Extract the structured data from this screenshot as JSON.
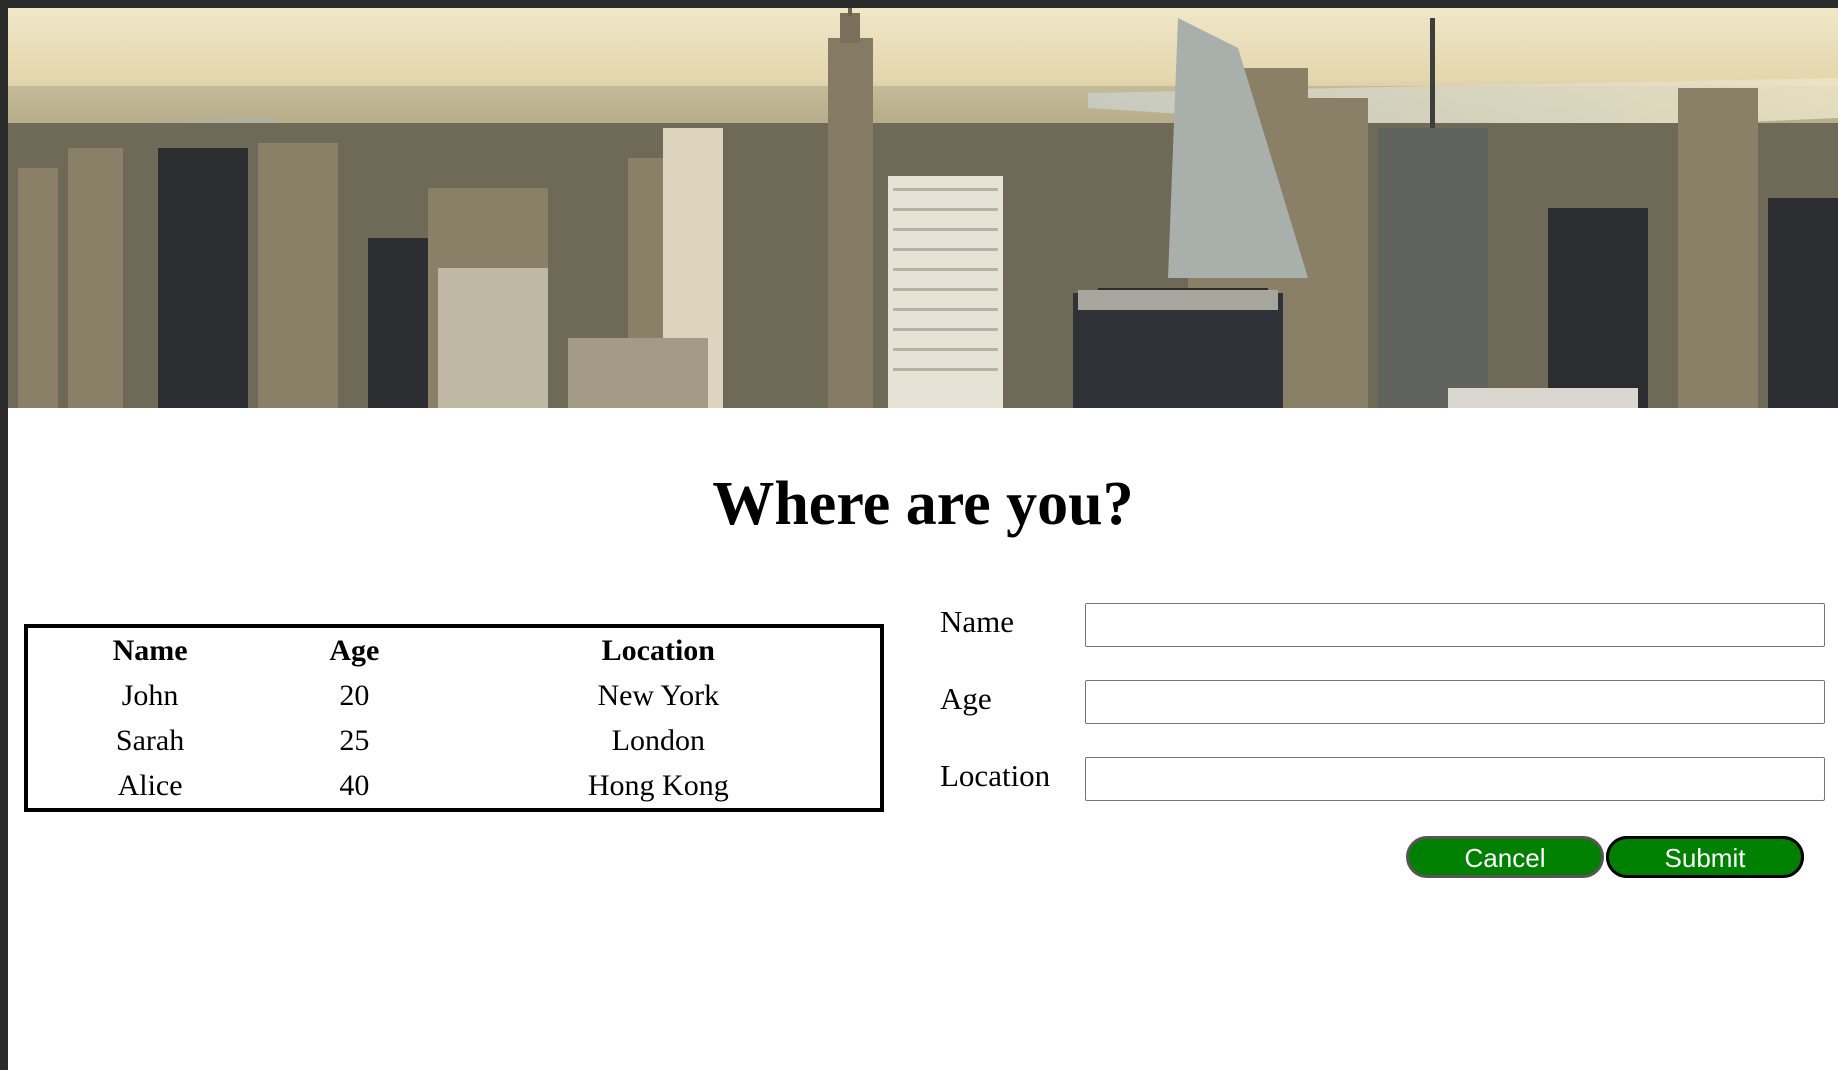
{
  "page": {
    "title": "Where are you?"
  },
  "table": {
    "headers": [
      "Name",
      "Age",
      "Location"
    ],
    "rows": [
      {
        "name": "John",
        "age": "20",
        "location": "New York"
      },
      {
        "name": "Sarah",
        "age": "25",
        "location": "London"
      },
      {
        "name": "Alice",
        "age": "40",
        "location": "Hong Kong"
      }
    ]
  },
  "form": {
    "name_label": "Name",
    "name_value": "",
    "age_label": "Age",
    "age_value": "",
    "location_label": "Location",
    "location_value": "",
    "cancel_label": "Cancel",
    "submit_label": "Submit"
  },
  "colors": {
    "button_green": "#008000",
    "frame": "#2b2b2b"
  }
}
